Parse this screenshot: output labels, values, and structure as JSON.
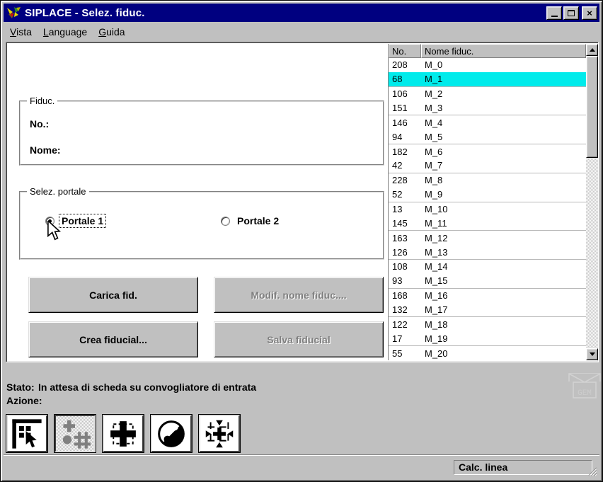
{
  "window": {
    "title": "SIPLACE - Selez. fiduc.",
    "controls": {
      "minimize": "minimize",
      "maximize": "maximize",
      "close": "×"
    }
  },
  "menu": {
    "items": [
      {
        "label": "Vista",
        "underline": 0
      },
      {
        "label": "Language",
        "underline": 0
      },
      {
        "label": "Guida",
        "underline": 0
      }
    ]
  },
  "fiduc_group": {
    "title": "Fiduc.",
    "no_label": "No.:",
    "no_value": "",
    "nome_label": "Nome:",
    "nome_value": ""
  },
  "portale_group": {
    "title": "Selez. portale",
    "options": [
      {
        "label": "Portale 1",
        "selected": true
      },
      {
        "label": "Portale 2",
        "selected": false
      }
    ]
  },
  "action_buttons": {
    "carica": {
      "label": "Carica fid.",
      "enabled": true
    },
    "modif": {
      "label": "Modif. nome fiduc....",
      "enabled": false
    },
    "crea": {
      "label": "Crea fiducial...",
      "enabled": true
    },
    "salva": {
      "label": "Salva fiducial",
      "enabled": false
    }
  },
  "table": {
    "columns": [
      "No.",
      "Nome fiduc."
    ],
    "selected_row_index": 1,
    "rows": [
      [
        "208",
        "M_0"
      ],
      [
        "68",
        "M_1"
      ],
      [
        "106",
        "M_2"
      ],
      [
        "151",
        "M_3"
      ],
      [
        "146",
        "M_4"
      ],
      [
        "94",
        "M_5"
      ],
      [
        "182",
        "M_6"
      ],
      [
        "42",
        "M_7"
      ],
      [
        "228",
        "M_8"
      ],
      [
        "52",
        "M_9"
      ],
      [
        "13",
        "M_10"
      ],
      [
        "145",
        "M_11"
      ],
      [
        "163",
        "M_12"
      ],
      [
        "126",
        "M_13"
      ],
      [
        "108",
        "M_14"
      ],
      [
        "93",
        "M_15"
      ],
      [
        "168",
        "M_16"
      ],
      [
        "132",
        "M_17"
      ],
      [
        "122",
        "M_18"
      ],
      [
        "17",
        "M_19"
      ],
      [
        "55",
        "M_20"
      ]
    ]
  },
  "status": {
    "stato_label": "Stato:",
    "stato_value": "In attesa di scheda su convogliatore di entrata",
    "azione_label": "Azione:",
    "azione_value": "",
    "gem_label": "GEM"
  },
  "toolbar": {
    "active_index": 1,
    "icons": [
      "select-pointer-icon",
      "fiducial-grid-icon",
      "cross-expand-icon",
      "contrast-circle-icon",
      "center-target-icon"
    ]
  },
  "statusbar": {
    "field_value": "Calc. linea"
  },
  "colors": {
    "titlebar": "#000080",
    "window_gray": "#c0c0c0",
    "selection_cyan": "#00ebeb",
    "disabled_text": "#808080"
  }
}
